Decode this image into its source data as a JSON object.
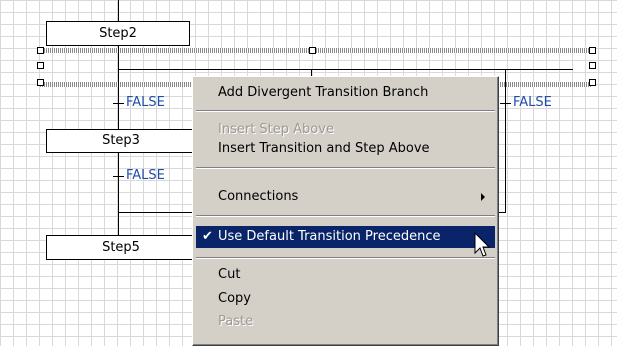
{
  "diagram": {
    "steps": [
      {
        "label": "Step2"
      },
      {
        "label": "Step3"
      },
      {
        "label": "Step5"
      }
    ],
    "conditions": {
      "left_1": "FALSE",
      "left_2": "FALSE",
      "right_1": "FALSE"
    }
  },
  "context_menu": {
    "add_divergent": "Add Divergent Transition Branch",
    "insert_step_above": "Insert Step Above",
    "insert_transition_step_above": "Insert Transition and Step Above",
    "connections": "Connections",
    "use_default_precedence": "Use Default Transition Precedence",
    "use_default_precedence_checked": true,
    "cut": "Cut",
    "copy": "Copy",
    "paste": "Paste"
  },
  "colors": {
    "condition_text": "#1f4ea8",
    "menu_bg": "#d4d0c8",
    "highlight": "#0a246a",
    "disabled_text": "#9d9a93"
  }
}
